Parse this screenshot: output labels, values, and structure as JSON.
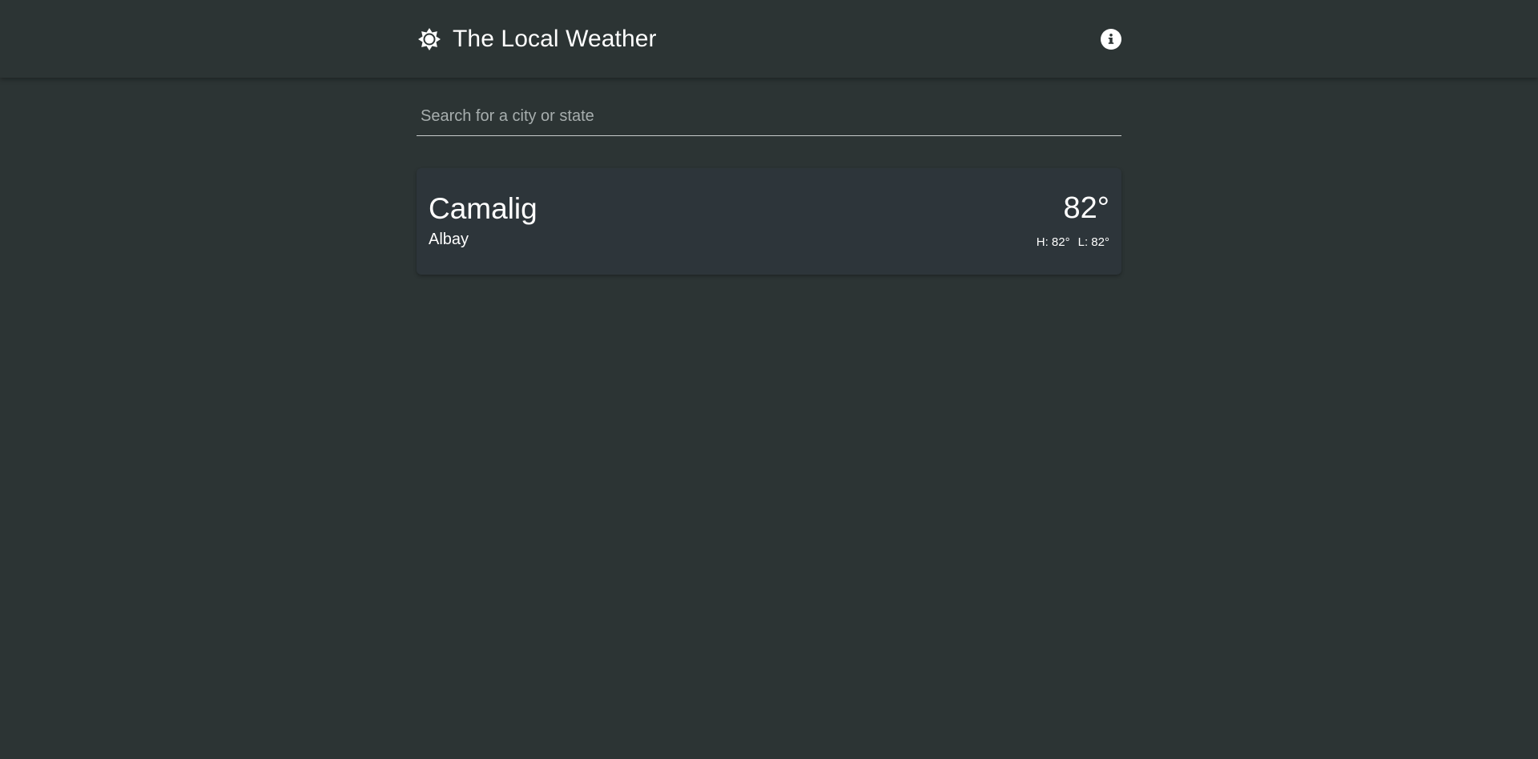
{
  "header": {
    "title": "The Local Weather",
    "logo_icon": "sun-icon",
    "info_icon": "info-icon"
  },
  "search": {
    "placeholder": "Search for a city or state",
    "value": ""
  },
  "locations": [
    {
      "city": "Camalig",
      "region": "Albay",
      "temperature": "82°",
      "high": "H: 82°",
      "low": "L: 82°"
    }
  ],
  "colors": {
    "background": "#2c3434",
    "card": "#2d353a",
    "text": "#ffffff",
    "placeholder": "#a7aeae"
  }
}
